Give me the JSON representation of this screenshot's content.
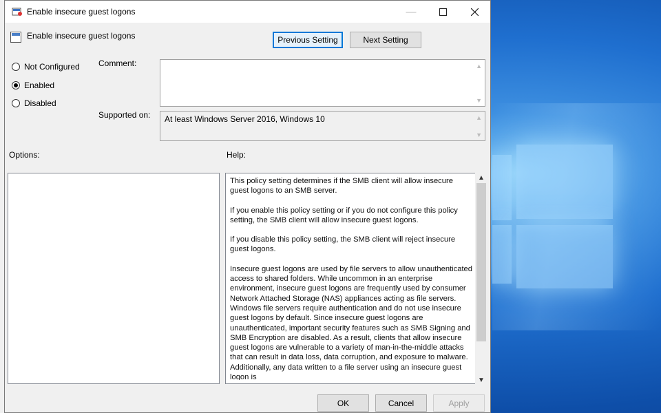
{
  "dialog": {
    "title": "Enable insecure guest logons",
    "header": "Enable insecure guest logons",
    "previous_label": "Previous Setting",
    "next_label": "Next Setting",
    "state": {
      "not_configured": "Not Configured",
      "enabled": "Enabled",
      "disabled": "Disabled",
      "selected": "enabled"
    },
    "comment_label": "Comment:",
    "comment_value": "",
    "supported_label": "Supported on:",
    "supported_value": "At least Windows Server 2016, Windows 10",
    "options_label": "Options:",
    "help_label": "Help:",
    "help_paragraphs": [
      "This policy setting determines if the SMB client will allow insecure guest logons to an SMB server.",
      "If you enable this policy setting or if you do not configure this policy setting, the SMB client will allow insecure guest logons.",
      "If you disable this policy setting, the SMB client will reject insecure guest logons.",
      "Insecure guest logons are used by file servers to allow unauthenticated access to shared folders. While uncommon in an enterprise environment, insecure guest logons are frequently used by consumer Network Attached Storage (NAS) appliances acting as file servers. Windows file servers require authentication and do not use insecure guest logons by default. Since insecure guest logons are unauthenticated, important security features such as SMB Signing and SMB Encryption are disabled. As a result, clients that allow insecure guest logons are vulnerable to a variety of man-in-the-middle attacks that can result in data loss, data corruption, and exposure to malware. Additionally, any data written to a file server using an insecure guest logon is"
    ],
    "ok_label": "OK",
    "cancel_label": "Cancel",
    "apply_label": "Apply"
  }
}
